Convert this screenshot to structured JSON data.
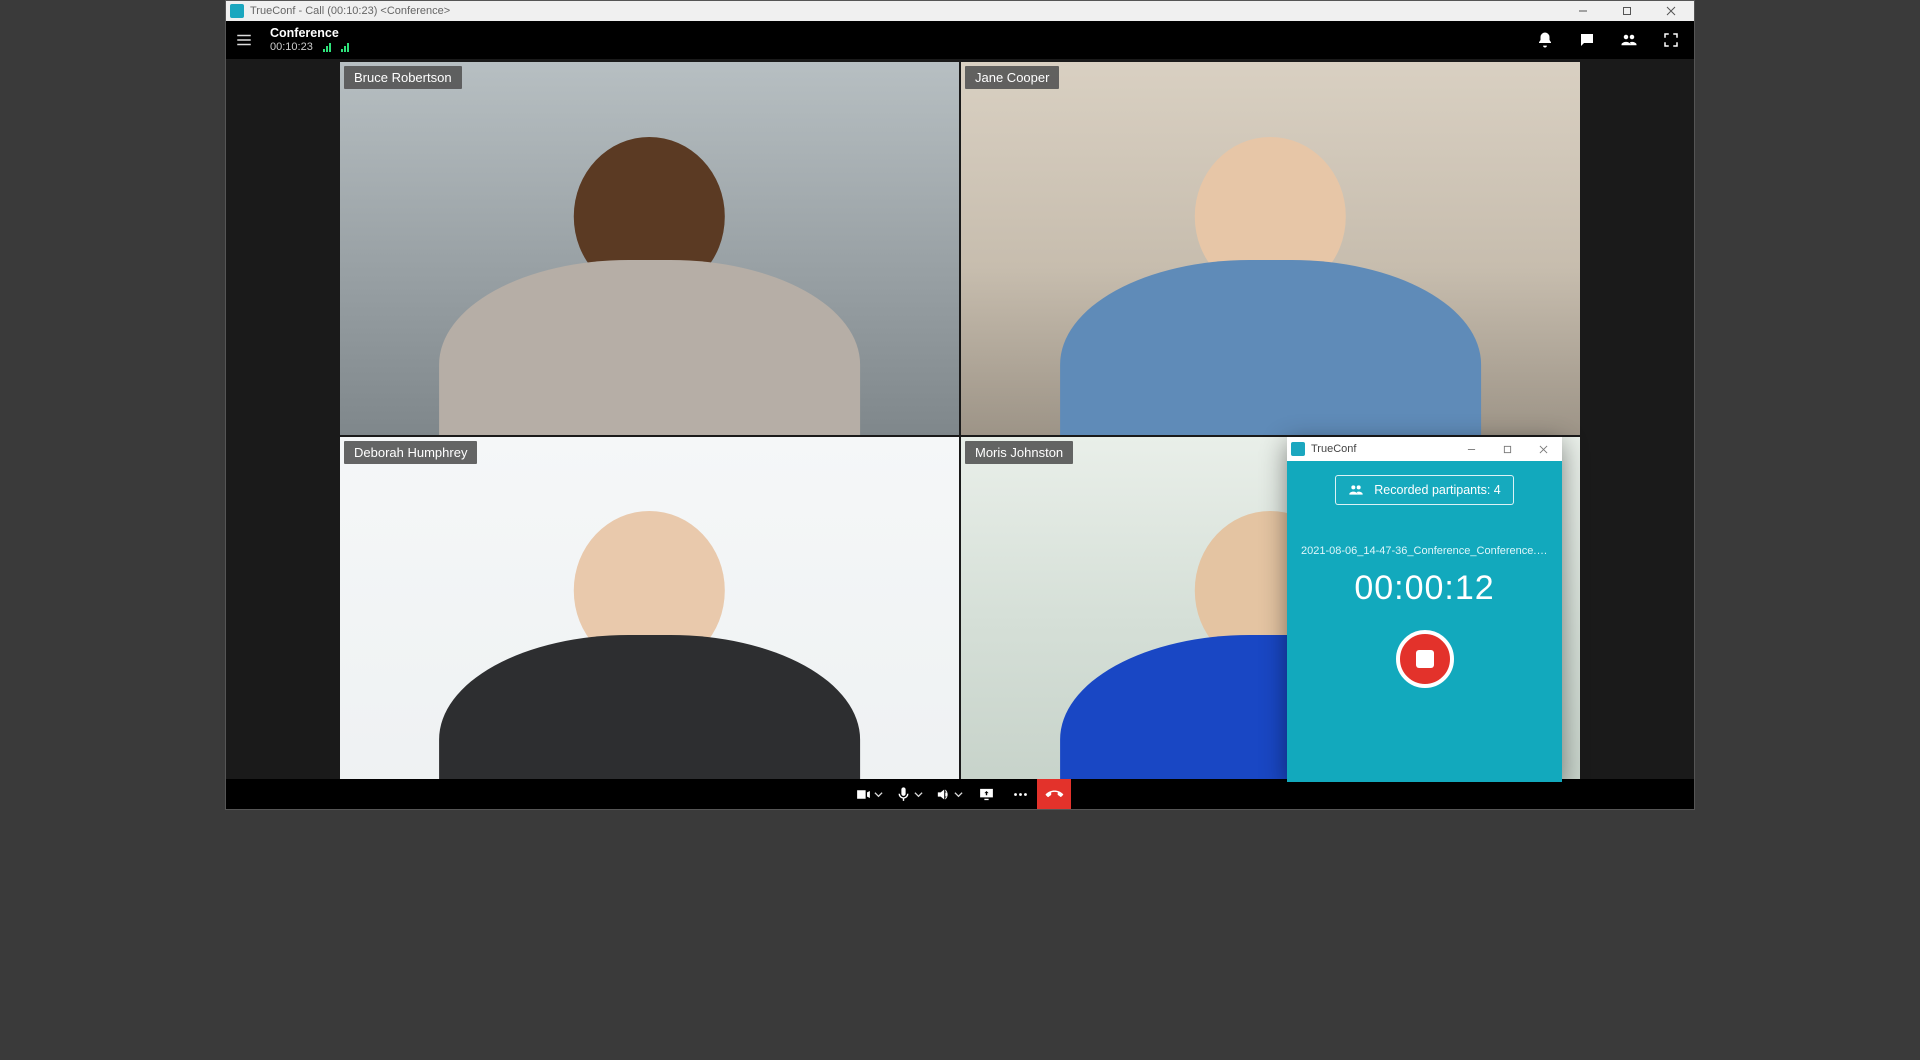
{
  "os_titlebar": {
    "app_name": "TrueConf",
    "title_suffix": " - Call (00:10:23) <Conference>"
  },
  "appbar": {
    "title": "Conference",
    "elapsed": "00:10:23"
  },
  "participants": [
    {
      "name": "Bruce Robertson",
      "active": true
    },
    {
      "name": "Jane Cooper",
      "active": false
    },
    {
      "name": "Deborah Humphrey",
      "active": false
    },
    {
      "name": "Moris Johnston",
      "active": false
    }
  ],
  "recorder": {
    "window_title": "TrueConf",
    "chip_label": "Recorded partipants: 4",
    "file_name": "2021-08-06_14-47-36_Conference_Conference.mp4",
    "elapsed": "00:00:12"
  }
}
